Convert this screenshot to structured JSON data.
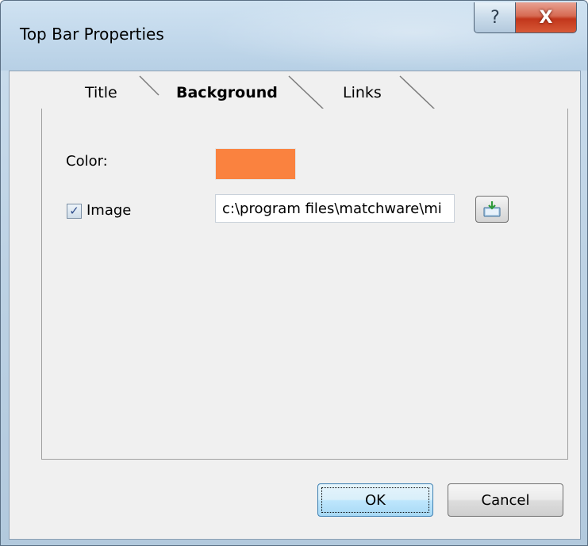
{
  "window": {
    "title": "Top Bar Properties",
    "help_label": "?",
    "close_label": "X"
  },
  "tabs": [
    {
      "label": "Title",
      "active": false
    },
    {
      "label": "Background",
      "active": true
    },
    {
      "label": "Links",
      "active": false
    }
  ],
  "background_tab": {
    "color_label": "Color:",
    "color_value": "#fa823f",
    "image_label": "Image",
    "image_checked": true,
    "image_path": "c:\\program files\\matchware\\mi",
    "browse_icon": "folder-open-icon"
  },
  "buttons": {
    "ok": "OK",
    "cancel": "Cancel"
  }
}
